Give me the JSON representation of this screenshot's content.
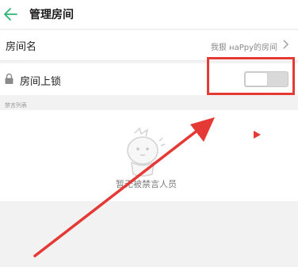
{
  "header": {
    "title": "管理房间"
  },
  "settings": {
    "room_name_label": "房间名",
    "room_name_value": "我狠 ʜaPpy的房间",
    "lock_label": "房间上锁",
    "lock_enabled": false
  },
  "mute_list": {
    "section_label": "禁言列表",
    "empty_text": "暂无被禁言人员"
  },
  "colors": {
    "accent_green": "#2bb673",
    "annotation_red": "#e53935"
  }
}
